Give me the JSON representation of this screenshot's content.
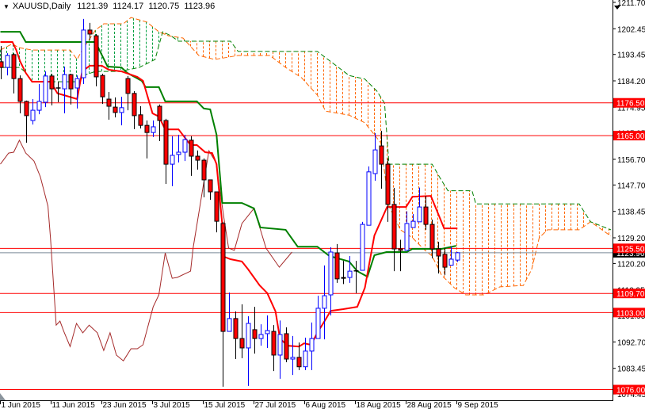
{
  "header": {
    "symbol": "XAUUSD,Daily",
    "open": "1121.39",
    "high": "1124.17",
    "low": "1120.75",
    "close": "1123.96"
  },
  "chart_data": {
    "type": "candlestick",
    "title": "XAUUSD,Daily",
    "ylim": [
      1074.45,
      1211.7
    ],
    "price_ticks": [
      "1211.70",
      "1202.45",
      "1193.45",
      "1184.20",
      "1174.95",
      "1165.95",
      "1156.70",
      "1147.70",
      "1138.45",
      "1129.20",
      "1120.20",
      "1110.95",
      "1101.95",
      "1092.70",
      "1083.45",
      "1074.45"
    ],
    "date_labels": [
      {
        "bar": 0,
        "label": "1 Jun 2015"
      },
      {
        "bar": 8,
        "label": "11 Jun 2015"
      },
      {
        "bar": 16,
        "label": "23 Jun 2015"
      },
      {
        "bar": 24,
        "label": "3 Jul 2015"
      },
      {
        "bar": 32,
        "label": "15 Jul 2015"
      },
      {
        "bar": 40,
        "label": "27 Jul 2015"
      },
      {
        "bar": 48,
        "label": "6 Aug 2015"
      },
      {
        "bar": 56,
        "label": "18 Aug 2015"
      },
      {
        "bar": 64,
        "label": "28 Aug 2015"
      },
      {
        "bar": 72,
        "label": "9 Sep 2015"
      }
    ],
    "ohlc": [
      [
        1190.9,
        1196.4,
        1184.8,
        1188.9
      ],
      [
        1188.9,
        1193.9,
        1186.1,
        1193.1
      ],
      [
        1193.4,
        1193.9,
        1179.8,
        1185.0
      ],
      [
        1185.0,
        1186.1,
        1172.8,
        1177.0
      ],
      [
        1177.0,
        1177.3,
        1162.5,
        1172.0
      ],
      [
        1170.3,
        1177.8,
        1168.9,
        1173.9
      ],
      [
        1173.9,
        1183.1,
        1172.5,
        1177.0
      ],
      [
        1176.7,
        1187.5,
        1175.0,
        1185.9
      ],
      [
        1185.9,
        1186.7,
        1175.6,
        1181.4
      ],
      [
        1181.7,
        1183.9,
        1176.7,
        1181.6
      ],
      [
        1181.4,
        1189.2,
        1172.8,
        1186.4
      ],
      [
        1186.4,
        1186.7,
        1175.9,
        1181.4
      ],
      [
        1181.7,
        1186.1,
        1174.5,
        1185.0
      ],
      [
        1185.3,
        1205.9,
        1183.1,
        1202.0
      ],
      [
        1202.0,
        1204.5,
        1198.6,
        1200.6
      ],
      [
        1200.0,
        1200.6,
        1182.3,
        1185.6
      ],
      [
        1186.1,
        1186.7,
        1176.1,
        1178.6
      ],
      [
        1177.8,
        1180.3,
        1170.6,
        1175.3
      ],
      [
        1175.0,
        1178.4,
        1171.4,
        1173.1
      ],
      [
        1173.1,
        1178.6,
        1168.6,
        1174.8
      ],
      [
        1185.0,
        1185.9,
        1173.9,
        1179.8
      ],
      [
        1179.8,
        1180.6,
        1167.3,
        1172.0
      ],
      [
        1172.3,
        1175.3,
        1167.5,
        1168.6
      ],
      [
        1168.6,
        1170.3,
        1157.0,
        1166.1
      ],
      [
        1166.1,
        1170.3,
        1164.5,
        1168.1
      ],
      [
        1175.3,
        1175.9,
        1163.1,
        1170.3
      ],
      [
        1170.3,
        1170.9,
        1148.1,
        1155.0
      ],
      [
        1155.0,
        1164.8,
        1147.3,
        1158.1
      ],
      [
        1158.4,
        1165.3,
        1155.6,
        1159.2
      ],
      [
        1159.2,
        1165.3,
        1156.1,
        1163.6
      ],
      [
        1163.4,
        1164.8,
        1150.9,
        1157.8
      ],
      [
        1157.8,
        1159.8,
        1153.1,
        1156.4
      ],
      [
        1156.4,
        1157.0,
        1143.4,
        1149.5
      ],
      [
        1149.5,
        1149.5,
        1142.5,
        1145.3
      ],
      [
        1145.3,
        1145.3,
        1131.1,
        1135.0
      ],
      [
        1134.2,
        1134.8,
        1077.0,
        1096.4
      ],
      [
        1096.4,
        1110.0,
        1096.4,
        1100.9
      ],
      [
        1100.9,
        1103.4,
        1086.7,
        1093.9
      ],
      [
        1093.9,
        1105.9,
        1087.0,
        1090.6
      ],
      [
        1090.6,
        1101.7,
        1077.3,
        1099.2
      ],
      [
        1097.0,
        1105.0,
        1088.6,
        1093.9
      ],
      [
        1093.9,
        1098.9,
        1091.4,
        1095.3
      ],
      [
        1095.6,
        1102.0,
        1090.6,
        1096.7
      ],
      [
        1096.4,
        1098.6,
        1082.5,
        1088.1
      ],
      [
        1088.1,
        1100.2,
        1079.8,
        1095.3
      ],
      [
        1095.6,
        1097.8,
        1085.6,
        1086.7
      ],
      [
        1086.7,
        1094.8,
        1081.1,
        1087.3
      ],
      [
        1087.3,
        1092.5,
        1082.8,
        1084.0
      ],
      [
        1084.0,
        1094.2,
        1082.8,
        1089.5
      ],
      [
        1089.5,
        1099.5,
        1082.8,
        1093.9
      ],
      [
        1093.9,
        1108.9,
        1093.9,
        1104.5
      ],
      [
        1104.5,
        1119.5,
        1093.6,
        1108.9
      ],
      [
        1109.2,
        1125.9,
        1102.0,
        1124.2
      ],
      [
        1123.9,
        1127.0,
        1113.4,
        1114.8
      ],
      [
        1115.3,
        1121.1,
        1113.0,
        1115.0
      ],
      [
        1115.3,
        1122.8,
        1113.4,
        1117.5
      ],
      [
        1117.5,
        1121.1,
        1109.8,
        1117.6
      ],
      [
        1117.8,
        1134.8,
        1117.8,
        1133.9
      ],
      [
        1133.6,
        1154.2,
        1133.6,
        1152.3
      ],
      [
        1151.7,
        1165.9,
        1149.2,
        1160.0
      ],
      [
        1161.4,
        1166.7,
        1146.4,
        1155.0
      ],
      [
        1155.0,
        1157.0,
        1134.8,
        1140.9
      ],
      [
        1140.9,
        1146.7,
        1117.5,
        1125.3
      ],
      [
        1125.3,
        1128.5,
        1117.5,
        1124.8
      ],
      [
        1124.8,
        1138.5,
        1124.8,
        1134.2
      ],
      [
        1132.8,
        1137.5,
        1132.8,
        1135.0
      ],
      [
        1134.8,
        1146.8,
        1134.8,
        1140.0
      ],
      [
        1140.0,
        1143.9,
        1132.0,
        1133.9
      ],
      [
        1133.9,
        1135.6,
        1122.0,
        1125.3
      ],
      [
        1125.3,
        1127.8,
        1116.7,
        1122.8
      ],
      [
        1123.4,
        1125.6,
        1116.1,
        1118.9
      ],
      [
        1119.6,
        1126.1,
        1119.6,
        1121.7
      ],
      [
        1121.39,
        1124.17,
        1120.75,
        1123.96
      ]
    ],
    "ichimoku": {
      "tenkan": [
        [
          0,
          1197.8
        ],
        [
          1.9,
          1197.8
        ],
        [
          2.5,
          1195.0
        ],
        [
          3.1,
          1191.1
        ],
        [
          4,
          1187.0
        ],
        [
          5,
          1183.9
        ],
        [
          7.9,
          1183.9
        ],
        [
          9,
          1179.8
        ],
        [
          10,
          1179.2
        ],
        [
          12.1,
          1177.8
        ],
        [
          12.9,
          1187.5
        ],
        [
          14.1,
          1189.5
        ],
        [
          16,
          1189.5
        ],
        [
          17.1,
          1188.1
        ],
        [
          19.1,
          1187.5
        ],
        [
          21.6,
          1185.6
        ],
        [
          22.5,
          1184.2
        ],
        [
          24,
          1172.8
        ],
        [
          25,
          1171.7
        ],
        [
          26,
          1167.2
        ],
        [
          28.1,
          1167.2
        ],
        [
          30,
          1161.7
        ],
        [
          31,
          1161.7
        ],
        [
          32.3,
          1159.2
        ],
        [
          33.4,
          1158.9
        ],
        [
          34.1,
          1155.0
        ],
        [
          35,
          1133.9
        ],
        [
          35,
          1122.8
        ],
        [
          36.3,
          1121.7
        ],
        [
          38.1,
          1120.9
        ],
        [
          39.1,
          1118.1
        ],
        [
          40.9,
          1112.5
        ],
        [
          42.1,
          1109.8
        ],
        [
          43.4,
          1103.4
        ],
        [
          44.1,
          1093.9
        ],
        [
          45.3,
          1091.4
        ],
        [
          47.1,
          1091.1
        ],
        [
          47.9,
          1092.2
        ],
        [
          49,
          1091.7
        ],
        [
          50,
          1095.9
        ],
        [
          51.3,
          1100.6
        ],
        [
          52.1,
          1103.6
        ],
        [
          54.1,
          1104.2
        ],
        [
          56.3,
          1105.0
        ],
        [
          57.5,
          1111.7
        ],
        [
          59,
          1130.0
        ],
        [
          61,
          1140.0
        ],
        [
          64,
          1140.0
        ],
        [
          65,
          1143.6
        ],
        [
          67.9,
          1143.9
        ],
        [
          70,
          1132.5
        ],
        [
          72.1,
          1132.5
        ]
      ],
      "kijun": [
        [
          0,
          1201.4
        ],
        [
          3.1,
          1201.4
        ],
        [
          4,
          1197.8
        ],
        [
          15,
          1197.8
        ],
        [
          16.9,
          1189.2
        ],
        [
          19.1,
          1188.9
        ],
        [
          20,
          1187.0
        ],
        [
          22.3,
          1184.2
        ],
        [
          22.9,
          1182.0
        ],
        [
          25,
          1182.0
        ],
        [
          26,
          1177.0
        ],
        [
          31,
          1177.0
        ],
        [
          32.1,
          1174.5
        ],
        [
          33.1,
          1174.2
        ],
        [
          34.1,
          1165.3
        ],
        [
          35,
          1141.4
        ],
        [
          38.1,
          1141.4
        ],
        [
          40,
          1139.5
        ],
        [
          41,
          1132.8
        ],
        [
          45,
          1132.0
        ],
        [
          46.9,
          1126.1
        ],
        [
          50,
          1126.1
        ],
        [
          51.9,
          1122.8
        ],
        [
          55,
          1120.9
        ],
        [
          56.3,
          1117.5
        ],
        [
          57.9,
          1115.6
        ],
        [
          59,
          1123.1
        ],
        [
          60.9,
          1124.2
        ],
        [
          64.1,
          1124.2
        ],
        [
          65,
          1125.3
        ],
        [
          69.6,
          1125.3
        ],
        [
          71.9,
          1126.4
        ]
      ],
      "chikou": [
        [
          0,
          1155.0
        ],
        [
          1.3,
          1158.9
        ],
        [
          2.1,
          1159.2
        ],
        [
          3,
          1163.4
        ],
        [
          4,
          1158.9
        ],
        [
          5.3,
          1156.1
        ],
        [
          6.3,
          1150.6
        ],
        [
          7.5,
          1140.3
        ],
        [
          7.9,
          1129.2
        ],
        [
          8.8,
          1098.6
        ],
        [
          9.4,
          1100.0
        ],
        [
          10,
          1096.4
        ],
        [
          11,
          1091.1
        ],
        [
          12,
          1099.2
        ],
        [
          13,
          1095.9
        ],
        [
          14,
          1098.6
        ],
        [
          15.3,
          1095.9
        ],
        [
          16.3,
          1089.7
        ],
        [
          17.3,
          1095.9
        ],
        [
          18.3,
          1088.1
        ],
        [
          19.4,
          1086.1
        ],
        [
          20.6,
          1090.3
        ],
        [
          21.6,
          1090.3
        ],
        [
          22.5,
          1091.7
        ],
        [
          24.1,
          1105.0
        ],
        [
          25,
          1109.2
        ],
        [
          26,
          1123.9
        ],
        [
          27.1,
          1115.0
        ],
        [
          27.9,
          1115.3
        ],
        [
          30,
          1117.5
        ],
        [
          30.4,
          1125.6
        ],
        [
          32.9,
          1159.7
        ],
        [
          34,
          1155.6
        ],
        [
          35.3,
          1135.6
        ],
        [
          36,
          1125.6
        ],
        [
          36.9,
          1124.8
        ],
        [
          38.1,
          1134.2
        ],
        [
          40,
          1139.5
        ],
        [
          41.9,
          1125.6
        ],
        [
          44,
          1118.9
        ],
        [
          46,
          1124.2
        ]
      ],
      "span_a": [
        [
          0,
          1195.0
        ],
        [
          1.9,
          1197.2
        ],
        [
          2.8,
          1195.9
        ],
        [
          5,
          1195.0
        ],
        [
          11,
          1195.0
        ],
        [
          12.1,
          1191.7
        ],
        [
          12.9,
          1195.0
        ],
        [
          15,
          1202.0
        ],
        [
          16.3,
          1204.2
        ],
        [
          19.4,
          1204.2
        ],
        [
          20.6,
          1206.4
        ],
        [
          23.1,
          1204.8
        ],
        [
          25,
          1201.4
        ],
        [
          26.5,
          1200.0
        ],
        [
          28.8,
          1199.2
        ],
        [
          31.3,
          1193.1
        ],
        [
          33.8,
          1191.7
        ],
        [
          37.5,
          1193.1
        ],
        [
          42.5,
          1193.1
        ],
        [
          45,
          1188.9
        ],
        [
          47.5,
          1185.3
        ],
        [
          50,
          1179.2
        ],
        [
          51.3,
          1173.6
        ],
        [
          55,
          1172.2
        ],
        [
          57.5,
          1169.5
        ],
        [
          60,
          1162.5
        ],
        [
          61.3,
          1140.3
        ],
        [
          63.1,
          1132.0
        ],
        [
          65,
          1129.2
        ],
        [
          66.9,
          1125.0
        ],
        [
          68.1,
          1122.8
        ],
        [
          69.6,
          1116.1
        ],
        [
          71.6,
          1111.7
        ],
        [
          73.4,
          1109.2
        ],
        [
          76.3,
          1109.2
        ],
        [
          78.8,
          1112.0
        ],
        [
          82.5,
          1112.5
        ],
        [
          83.8,
          1118.1
        ],
        [
          85,
          1129.2
        ],
        [
          86.3,
          1132.0
        ],
        [
          91.3,
          1132.0
        ],
        [
          93.1,
          1134.8
        ],
        [
          96.3,
          1129.8
        ]
      ],
      "span_b": [
        [
          0,
          1188.9
        ],
        [
          3.1,
          1188.9
        ],
        [
          3.8,
          1187.5
        ],
        [
          5,
          1183.9
        ],
        [
          12.5,
          1183.9
        ],
        [
          13.1,
          1186.1
        ],
        [
          15,
          1187.5
        ],
        [
          18.8,
          1187.5
        ],
        [
          21.9,
          1188.9
        ],
        [
          24.4,
          1191.7
        ],
        [
          25.6,
          1201.4
        ],
        [
          26.9,
          1200.0
        ],
        [
          28.1,
          1198.1
        ],
        [
          36.3,
          1198.1
        ],
        [
          37.5,
          1194.5
        ],
        [
          50,
          1194.5
        ],
        [
          52.5,
          1190.3
        ],
        [
          55,
          1186.1
        ],
        [
          57.5,
          1184.8
        ],
        [
          59.4,
          1180.6
        ],
        [
          60.6,
          1176.4
        ],
        [
          61.3,
          1155.0
        ],
        [
          68.1,
          1155.0
        ],
        [
          69.4,
          1150.0
        ],
        [
          70.6,
          1145.7
        ],
        [
          74.4,
          1145.7
        ],
        [
          75,
          1141.1
        ],
        [
          91.3,
          1141.1
        ],
        [
          93.1,
          1134.8
        ],
        [
          96.3,
          1132.0
        ]
      ]
    },
    "levels": [
      {
        "price": 1176.5,
        "label": "1176.50"
      },
      {
        "price": 1165.0,
        "label": "1165.00"
      },
      {
        "price": 1125.5,
        "label": "1125.50"
      },
      {
        "price": 1109.7,
        "label": "1109.70"
      },
      {
        "price": 1103.0,
        "label": "1103.00"
      },
      {
        "price": 1076.0,
        "label": "1076.00"
      }
    ],
    "current_price": {
      "price": 1123.96,
      "label": "1123.96"
    },
    "colors": {
      "bull": "#0000ff",
      "bear": "#ff0000",
      "tenkan": "#ff0000",
      "kijun": "#008000",
      "chikou": "#a52a2a",
      "cloud_up": "#00a040",
      "cloud_down": "#ff6600",
      "level": "#ff0000",
      "current": "#7a8a99"
    }
  }
}
